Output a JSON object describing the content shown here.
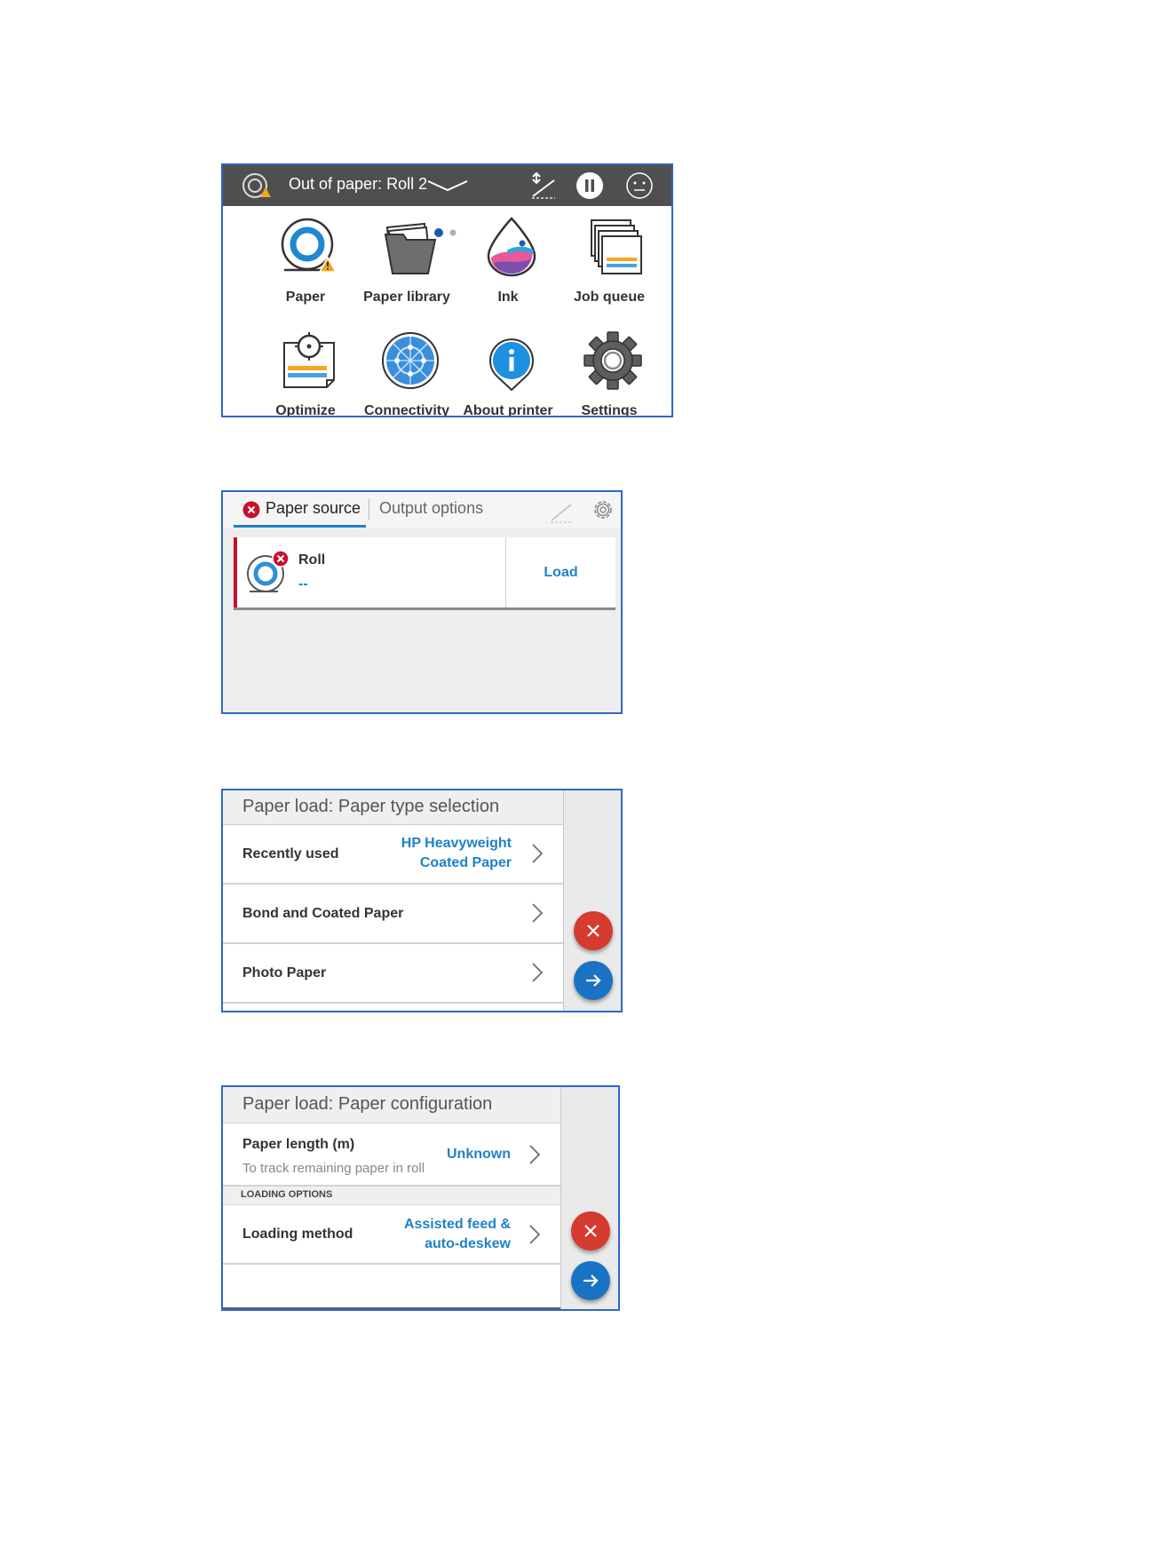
{
  "home": {
    "status_text": "Out of paper: Roll 2",
    "tiles": [
      {
        "label": "Paper",
        "icon": "paper-roll-warning-icon"
      },
      {
        "label": "Paper library",
        "icon": "paper-library-icon"
      },
      {
        "label": "Ink",
        "icon": "ink-drop-icon"
      },
      {
        "label": "Job queue",
        "icon": "job-queue-icon"
      },
      {
        "label": "Optimize",
        "icon": "optimize-icon"
      },
      {
        "label": "Connectivity",
        "icon": "connectivity-icon"
      },
      {
        "label": "About printer",
        "icon": "about-printer-icon"
      },
      {
        "label": "Settings",
        "icon": "settings-gear-icon"
      }
    ],
    "page_indicator": {
      "pages": 2,
      "active": 1
    }
  },
  "source": {
    "tabs": [
      {
        "label": "Paper source",
        "active": true,
        "status": "error"
      },
      {
        "label": "Output options",
        "active": false
      }
    ],
    "roll": {
      "name": "Roll",
      "value": "--",
      "action": "Load"
    }
  },
  "type_selection": {
    "title": "Paper load: Paper type selection",
    "rows": [
      {
        "label": "Recently used",
        "value_line1": "HP Heavyweight",
        "value_line2": "Coated Paper"
      },
      {
        "label": "Bond and Coated Paper"
      },
      {
        "label": "Photo Paper"
      }
    ]
  },
  "configuration": {
    "title": "Paper load: Paper configuration",
    "length": {
      "label": "Paper length (m)",
      "hint": "To track remaining paper in roll",
      "value": "Unknown"
    },
    "section": "LOADING OPTIONS",
    "method": {
      "label": "Loading method",
      "value_line1": "Assisted feed &",
      "value_line2": "auto-deskew"
    }
  },
  "colors": {
    "accent": "#1f82c7",
    "cancel": "#d63b2f",
    "confirm": "#1a73c2",
    "error": "#c8102e",
    "topbar": "#4f4f4f"
  }
}
